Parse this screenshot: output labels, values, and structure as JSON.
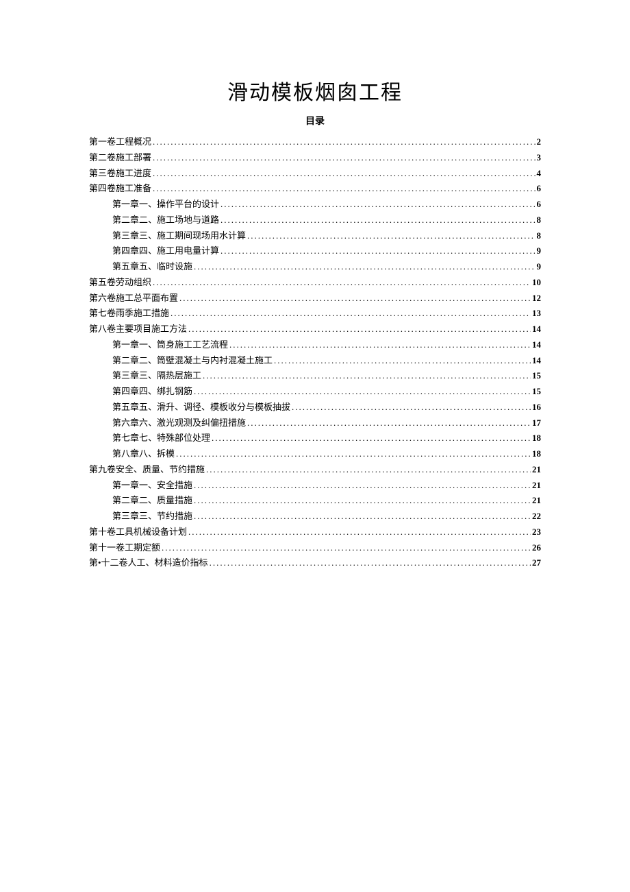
{
  "title": "滑动模板烟囱工程",
  "toc_heading": "目录",
  "toc": [
    {
      "level": 1,
      "label": "第一卷工程概况",
      "page": "2"
    },
    {
      "level": 1,
      "label": "第二卷施工部署",
      "page": "3"
    },
    {
      "level": 1,
      "label": "第三卷施工进度",
      "page": "4"
    },
    {
      "level": 1,
      "label": "第四卷施工准备",
      "page": "6"
    },
    {
      "level": 2,
      "label": "第一章一、操作平台的设计",
      "page": "6"
    },
    {
      "level": 2,
      "label": "第二章二、施工场地与道路",
      "page": "8"
    },
    {
      "level": 2,
      "label": "第三章三、施工期间现场用水计算",
      "page": "8"
    },
    {
      "level": 2,
      "label": "第四章四、施工用电量计算",
      "page": "9"
    },
    {
      "level": 2,
      "label": "第五章五、临时设施",
      "page": "9"
    },
    {
      "level": 1,
      "label": "第五卷劳动组织",
      "page": "10"
    },
    {
      "level": 1,
      "label": "第六卷施工总平面布置",
      "page": "12"
    },
    {
      "level": 1,
      "label": "第七卷雨季施工措施",
      "page": "13"
    },
    {
      "level": 1,
      "label": "第八卷主要项目施工方法",
      "page": "14"
    },
    {
      "level": 2,
      "label": "第一章一、筒身施工工艺流程",
      "page": "14"
    },
    {
      "level": 2,
      "label": "第二章二、筒壁混凝土与内衬混凝土施工",
      "page": "14"
    },
    {
      "level": 2,
      "label": "第三章三、隔热层施工",
      "page": "15"
    },
    {
      "level": 2,
      "label": "第四章四、绑扎钢筋",
      "page": "15"
    },
    {
      "level": 2,
      "label": "第五章五、滑升、调径、模板收分与模板抽拔",
      "page": "16"
    },
    {
      "level": 2,
      "label": "第六章六、激光观测及纠偏扭措施",
      "page": "17"
    },
    {
      "level": 2,
      "label": "第七章七、特殊部位处理",
      "page": "18"
    },
    {
      "level": 2,
      "label": "第八章八、拆模",
      "page": "18"
    },
    {
      "level": 1,
      "label": "第九卷安全、质量、节约措施",
      "page": "21"
    },
    {
      "level": 2,
      "label": "第一章一、安全措施",
      "page": "21"
    },
    {
      "level": 2,
      "label": "第二章二、质量措施",
      "page": "21"
    },
    {
      "level": 2,
      "label": "第三章三、节约措施",
      "page": "22"
    },
    {
      "level": 1,
      "label": "第十卷工具机械设备计划",
      "page": "23"
    },
    {
      "level": 1,
      "label": "第十一卷工期定额",
      "page": "26"
    },
    {
      "level": 1,
      "label": "第•十二卷人工、材料造价指标",
      "page": "27"
    }
  ]
}
